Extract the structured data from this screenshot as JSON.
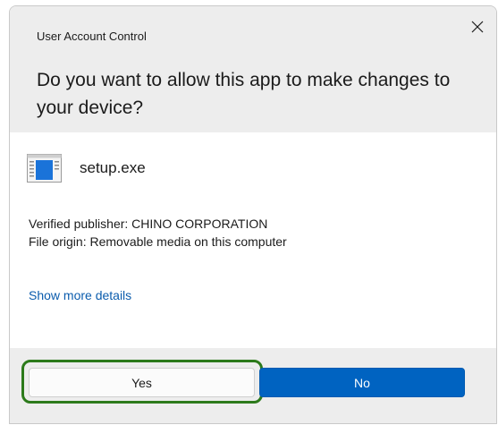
{
  "dialog": {
    "title": "User Account Control",
    "prompt": "Do you want to allow this app to make changes to your device?",
    "close_icon": "close-icon"
  },
  "app": {
    "icon": "executable-app-icon",
    "name": "setup.exe"
  },
  "details": {
    "publisher": "Verified publisher: CHINO CORPORATION",
    "origin": "File origin: Removable media on this computer",
    "more_link": "Show more details"
  },
  "buttons": {
    "yes_label": "Yes",
    "no_label": "No"
  },
  "colors": {
    "accent_blue": "#0063c1",
    "link_blue": "#0b5cad",
    "highlight_green": "#2c7a1b",
    "header_gray": "#ededed"
  }
}
